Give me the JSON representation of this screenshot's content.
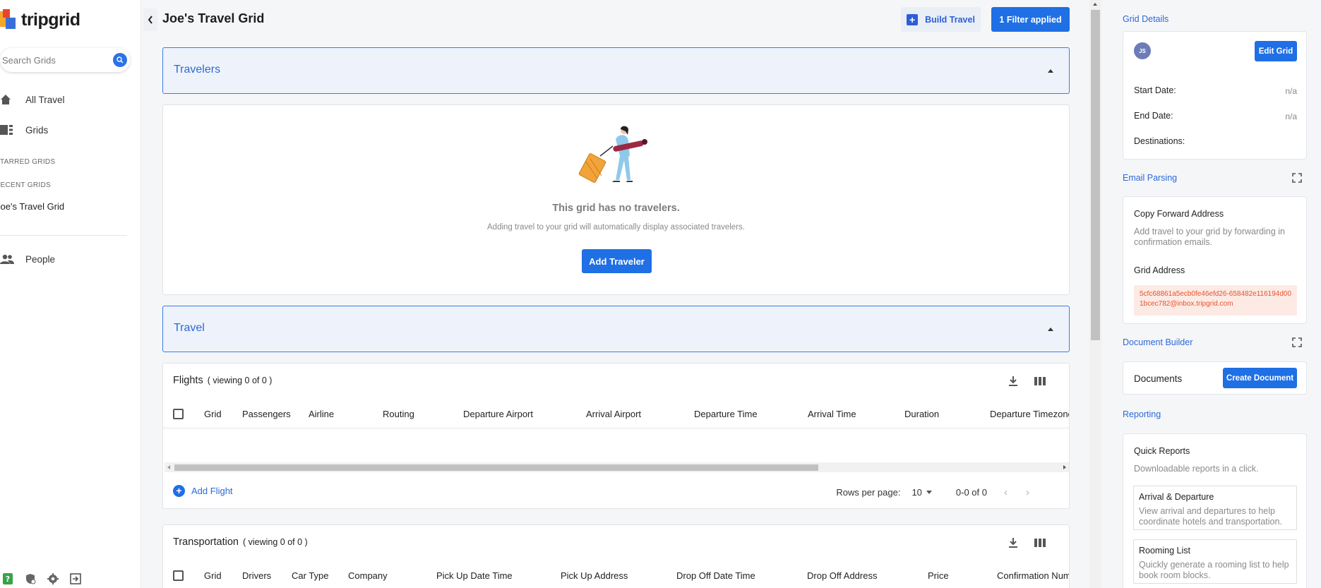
{
  "app": {
    "name": "tripgrid",
    "accent": "#1f6fe5"
  },
  "sidebar": {
    "search_placeholder": "Search Grids",
    "nav": [
      {
        "label": "All Travel",
        "icon": "home-icon"
      },
      {
        "label": "Grids",
        "icon": "grid-icon"
      }
    ],
    "starred_label": "STARRED GRIDS",
    "recent_label": "RECENT GRIDS",
    "recent_items": [
      "Joe's Travel Grid"
    ],
    "people_label": "People",
    "bottom_icons": [
      "help-icon",
      "security-icon",
      "settings-icon",
      "logout-icon"
    ]
  },
  "header": {
    "title": "Joe's Travel Grid",
    "build_travel": "Build Travel",
    "filter": "1 Filter applied"
  },
  "travelers": {
    "section_label": "Travelers",
    "empty_title": "This grid has no travelers.",
    "empty_subtitle": "Adding travel to your grid will automatically display associated travelers.",
    "add_button": "Add Traveler"
  },
  "travel": {
    "section_label": "Travel"
  },
  "flights": {
    "title": "Flights",
    "viewing": "( viewing 0 of 0 )",
    "columns": [
      "Grid",
      "Passengers",
      "Airline",
      "Routing",
      "Departure Airport",
      "Arrival Airport",
      "Departure Time",
      "Arrival Time",
      "Duration",
      "Departure Timezone"
    ],
    "add_label": "Add Flight",
    "rows_per_page_label": "Rows per page:",
    "rows_per_page": "10",
    "range": "0-0 of 0"
  },
  "transportation": {
    "title": "Transportation",
    "viewing": "( viewing 0 of 0 )",
    "columns": [
      "Grid",
      "Drivers",
      "Car Type",
      "Company",
      "Pick Up Date Time",
      "Pick Up Address",
      "Drop Off Date Time",
      "Drop Off Address",
      "Price",
      "Confirmation Number"
    ]
  },
  "right_panel": {
    "grid_details": {
      "title": "Grid Details",
      "avatar_initials": "JS",
      "edit_button": "Edit Grid",
      "start_label": "Start Date:",
      "start_value": "n/a",
      "end_label": "End Date:",
      "end_value": "n/a",
      "destinations_label": "Destinations:"
    },
    "email_parsing": {
      "title": "Email Parsing",
      "copy_title": "Copy Forward Address",
      "copy_desc": "Add travel to your grid by forwarding in confirmation emails.",
      "address_title": "Grid Address",
      "address": "5cfc68861a5ecb0fe46efd26-658482e116194d001bcec782@inbox.tripgrid.com"
    },
    "document_builder": {
      "title": "Document Builder",
      "documents_label": "Documents",
      "create_button": "Create Document"
    },
    "reporting": {
      "title": "Reporting",
      "quick_title": "Quick Reports",
      "quick_desc": "Downloadable reports in a click.",
      "reports": [
        {
          "title": "Arrival & Departure",
          "desc": "View arrival and departures to help coordinate hotels and transportation."
        },
        {
          "title": "Rooming List",
          "desc": "Quickly generate a rooming list to help book room blocks."
        }
      ]
    }
  }
}
